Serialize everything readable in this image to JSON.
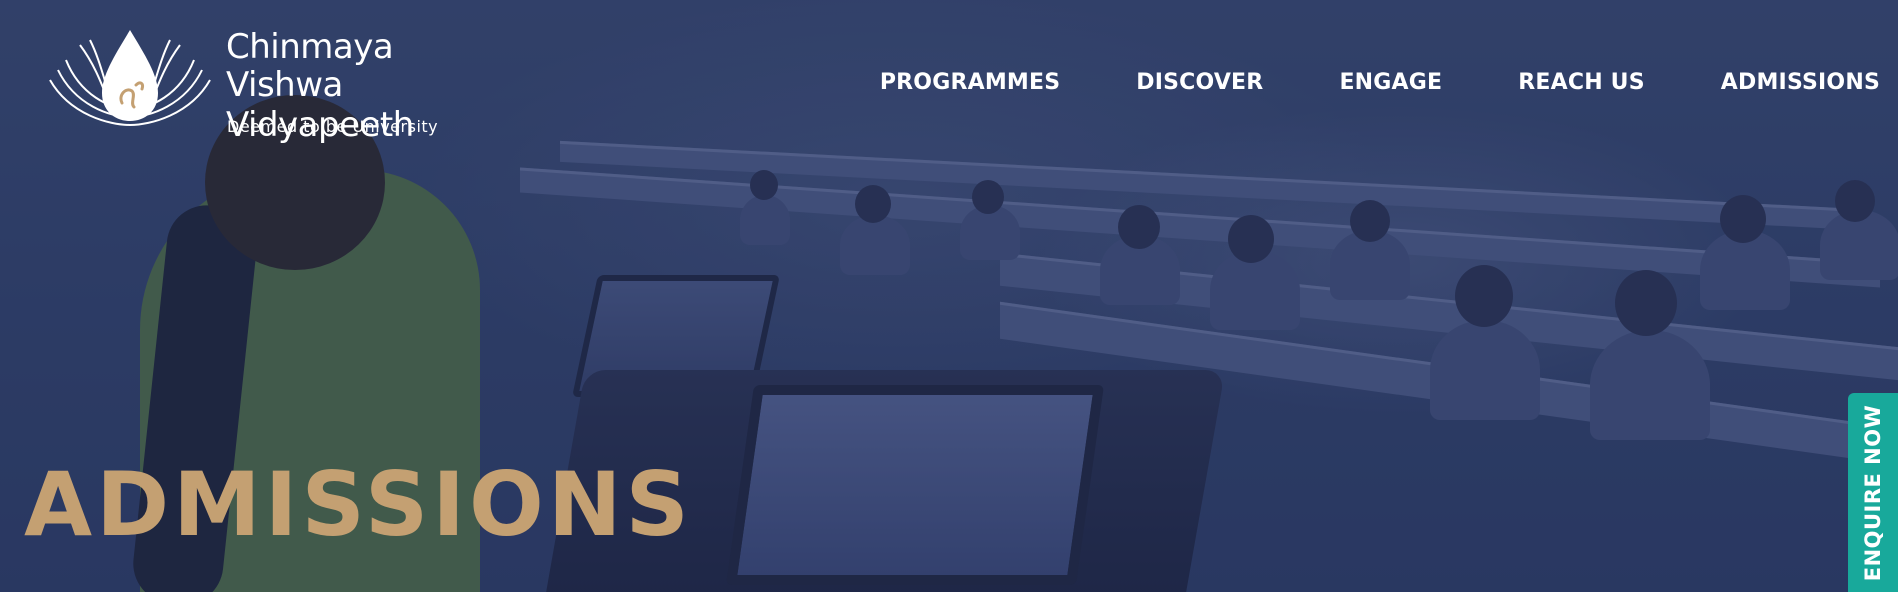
{
  "header": {
    "logo": {
      "line1": "Chinmaya",
      "line2": "Vishwa Vidyapeeth",
      "tagline": "Deemed to be University"
    },
    "nav": [
      {
        "label": "PROGRAMMES"
      },
      {
        "label": "DISCOVER"
      },
      {
        "label": "ENGAGE"
      },
      {
        "label": "REACH US"
      },
      {
        "label": "ADMISSIONS"
      }
    ]
  },
  "hero": {
    "title": "ADMISSIONS",
    "background_image": "classroom-with-teacher-and-students"
  },
  "enquire": {
    "label": "ENQUIRE NOW"
  },
  "colors": {
    "overlay": "#2d3b64",
    "title": "#c4a072",
    "enquire": "#18a99b",
    "nav_text": "#ffffff"
  }
}
